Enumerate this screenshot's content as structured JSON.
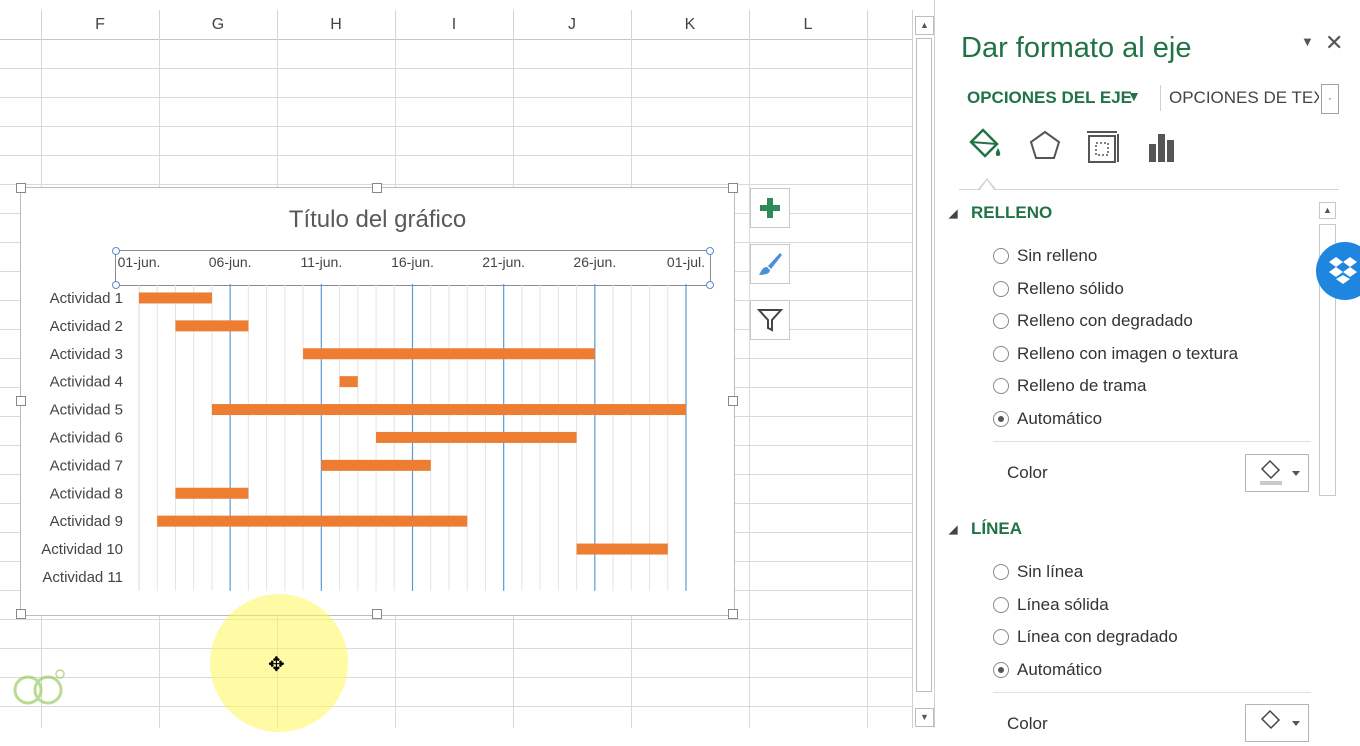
{
  "sheet": {
    "columns": [
      "F",
      "G",
      "H",
      "I",
      "J",
      "K",
      "L"
    ]
  },
  "chart": {
    "title": "Título del gráfico"
  },
  "chart_data": {
    "type": "bar",
    "orientation": "horizontal-gantt",
    "title": "Título del gráfico",
    "x_axis_position": "top",
    "x_ticks": [
      "01-jun.",
      "06-jun.",
      "11-jun.",
      "16-jun.",
      "21-jun.",
      "26-jun.",
      "01-jul."
    ],
    "xlim": [
      "01-jun.",
      "01-jul."
    ],
    "categories": [
      "Actividad 1",
      "Actividad 2",
      "Actividad 3",
      "Actividad 4",
      "Actividad 5",
      "Actividad 6",
      "Actividad 7",
      "Actividad 8",
      "Actividad 9",
      "Actividad 10",
      "Actividad 11"
    ],
    "series": [
      {
        "bars": [
          {
            "start": "01-jun.",
            "end": "05-jun."
          },
          {
            "start": "03-jun.",
            "end": "07-jun."
          },
          {
            "start": "10-jun.",
            "end": "26-jun."
          },
          {
            "start": "12-jun.",
            "end": "13-jun."
          },
          {
            "start": "05-jun.",
            "end": "01-jul."
          },
          {
            "start": "14-jun.",
            "end": "25-jun."
          },
          {
            "start": "11-jun.",
            "end": "17-jun."
          },
          {
            "start": "03-jun.",
            "end": "07-jun."
          },
          {
            "start": "02-jun.",
            "end": "19-jun."
          },
          {
            "start": "25-jun.",
            "end": "30-jun."
          },
          null
        ],
        "color": "#ED7D31"
      }
    ],
    "major_gridline_color": "#5B9BD5",
    "grid": true,
    "legend": "none"
  },
  "side_buttons": [
    "plus-icon",
    "brush-icon",
    "filter-icon"
  ],
  "pane": {
    "title": "Dar formato al eje",
    "tab_axis": "OPCIONES DEL EJE",
    "tab_text": "OPCIONES DE TEXTO",
    "icons": [
      "fill-line-icon",
      "effects-icon",
      "size-properties-icon",
      "axis-options-icon"
    ],
    "fill": {
      "header": "RELLENO",
      "options": [
        "Sin relleno",
        "Relleno sólido",
        "Relleno con degradado",
        "Relleno con imagen o textura",
        "Relleno de trama",
        "Automático"
      ],
      "selected": 5,
      "color_label": "Color"
    },
    "line": {
      "header": "LÍNEA",
      "options": [
        "Sin línea",
        "Línea sólida",
        "Línea con degradado",
        "Automático"
      ],
      "selected": 3,
      "color_label": "Color"
    }
  },
  "accent_color": "#217346",
  "bar_color": "#ED7D31"
}
